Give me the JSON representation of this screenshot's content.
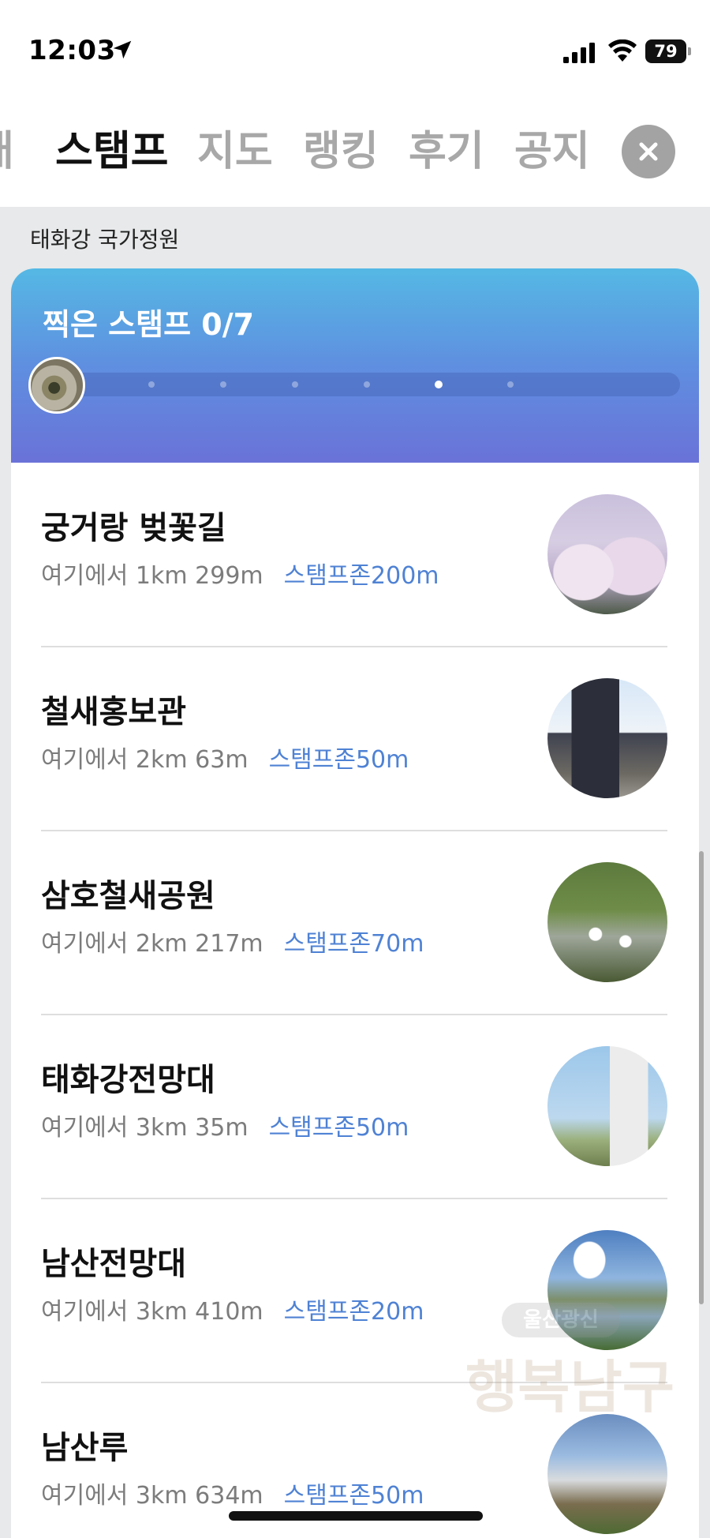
{
  "status_bar": {
    "time": "12:03",
    "battery": "79",
    "icons": [
      "location-arrow-icon",
      "signal-icon",
      "wifi-icon",
      "battery-icon"
    ]
  },
  "tabs": [
    {
      "label": "개",
      "active": false
    },
    {
      "label": "스탬프",
      "active": true
    },
    {
      "label": "지도",
      "active": false
    },
    {
      "label": "랭킹",
      "active": false
    },
    {
      "label": "후기",
      "active": false
    },
    {
      "label": "공지",
      "active": false
    }
  ],
  "garden_title": "태화강 국가정원",
  "stamp_header": {
    "label": "찍은 스탬프 0/7",
    "collected": 0,
    "total": 7,
    "current_step": 6
  },
  "items": [
    {
      "name": "궁거랑 벚꽃길",
      "distance": "여기에서 1km 299m",
      "zone": "스탬프존200m"
    },
    {
      "name": "철새홍보관",
      "distance": "여기에서 2km 63m",
      "zone": "스탬프존50m"
    },
    {
      "name": "삼호철새공원",
      "distance": "여기에서 2km 217m",
      "zone": "스탬프존70m"
    },
    {
      "name": "태화강전망대",
      "distance": "여기에서 3km 35m",
      "zone": "스탬프존50m"
    },
    {
      "name": "남산전망대",
      "distance": "여기에서 3km 410m",
      "zone": "스탬프존20m"
    },
    {
      "name": "남산루",
      "distance": "여기에서 3km 634m",
      "zone": "스탬프존50m"
    }
  ],
  "watermark": {
    "badge": "울산광신",
    "text": "행복남구"
  },
  "colors": {
    "accent_blue": "#4f82d4",
    "header_top": "#55b8e4",
    "header_bottom": "#6a72d8"
  }
}
